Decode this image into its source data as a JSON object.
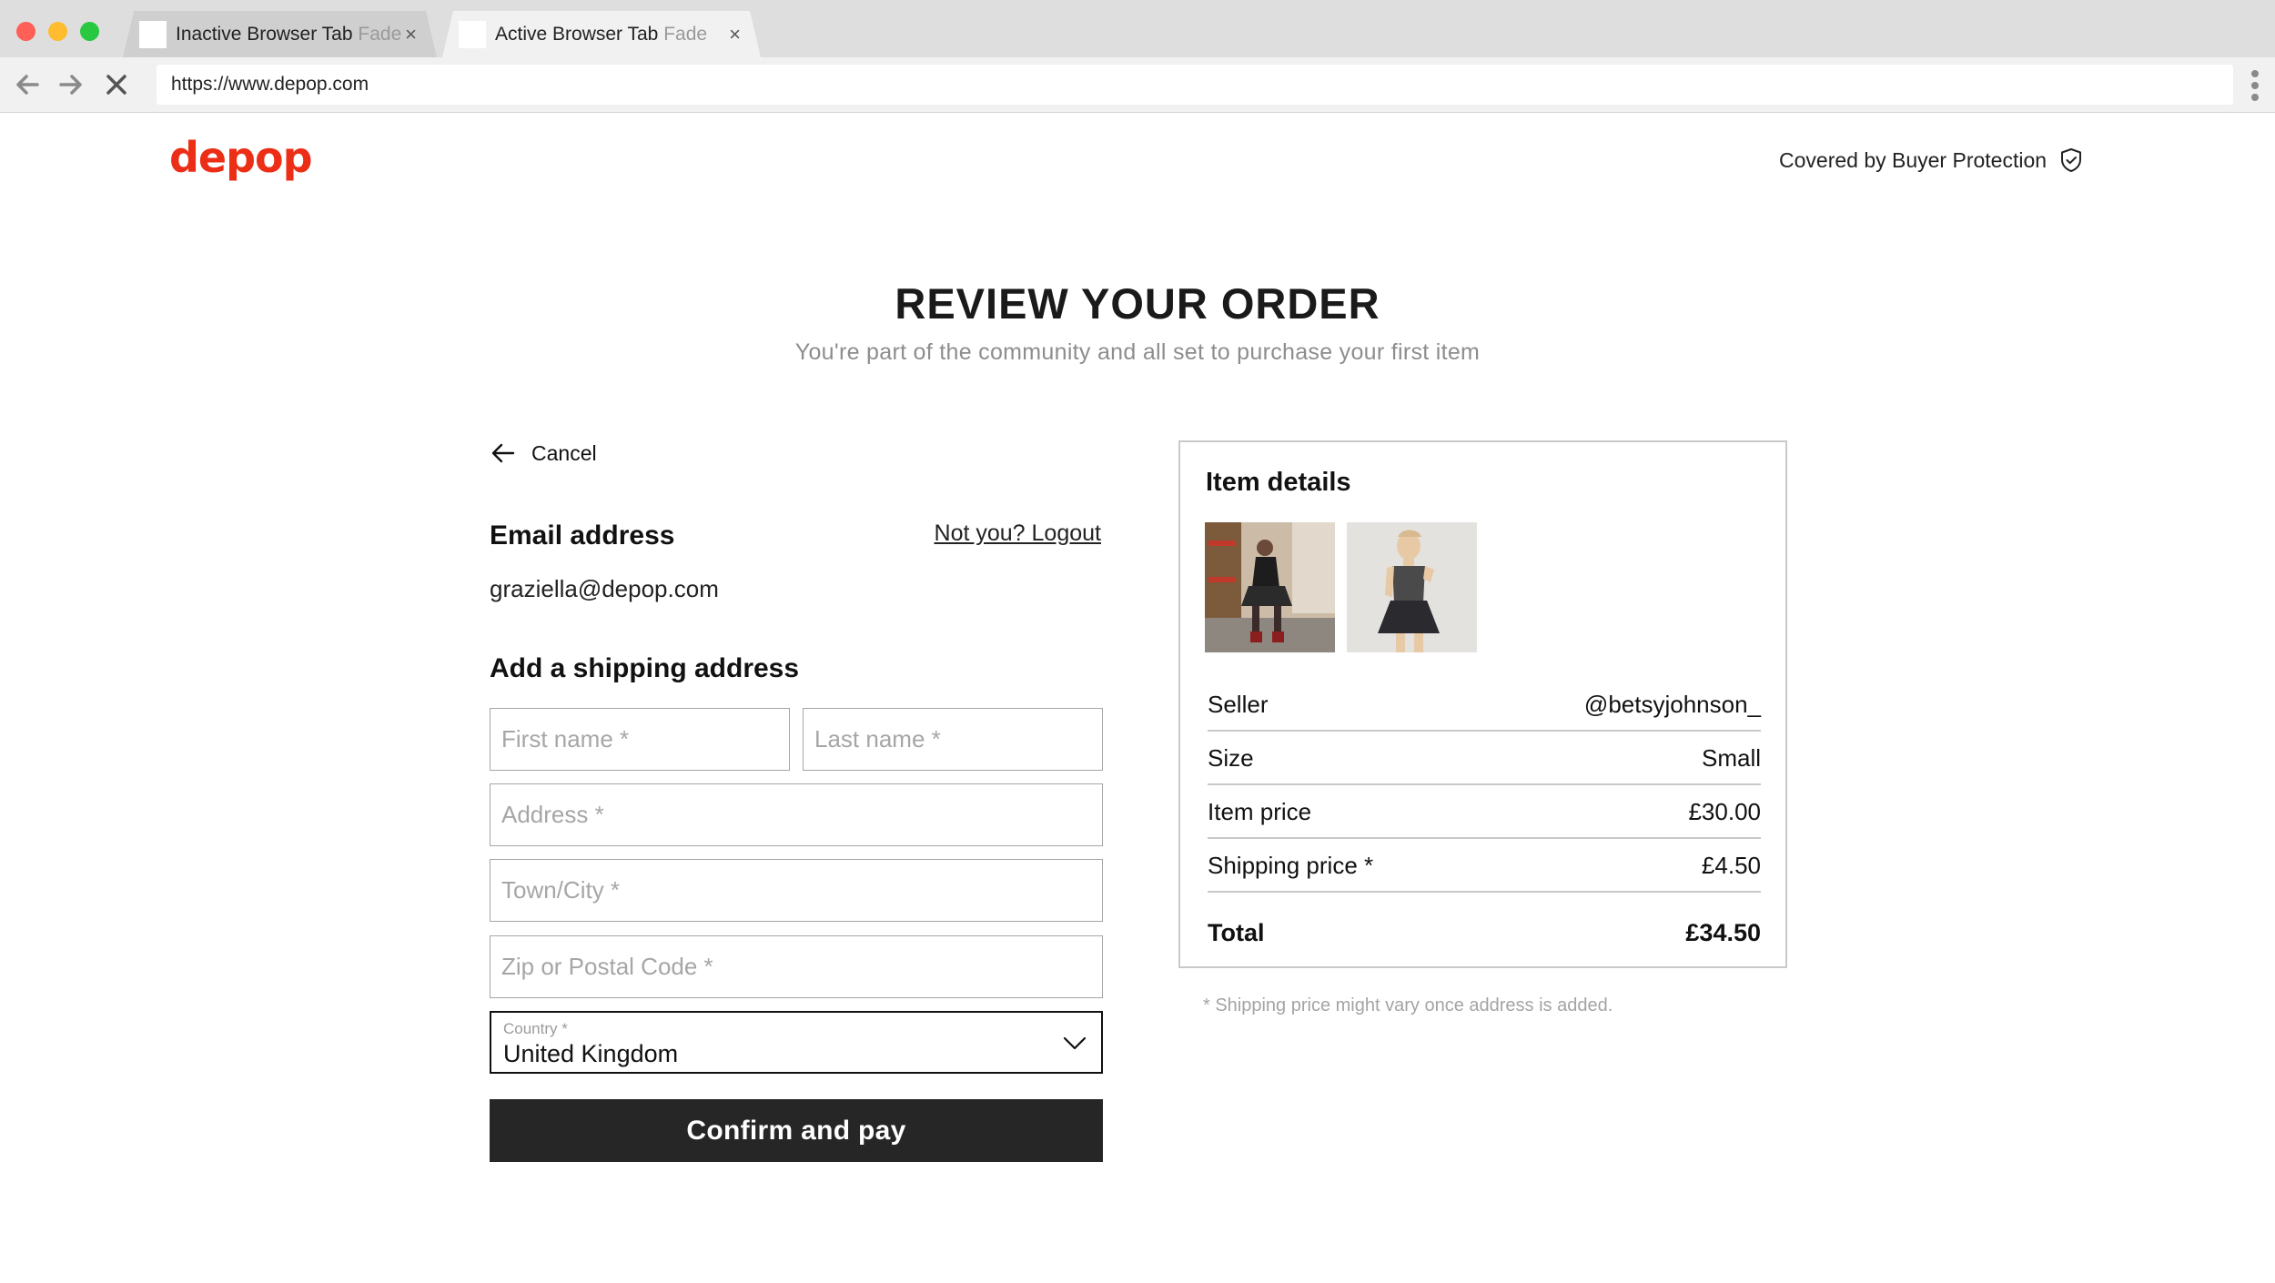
{
  "browser": {
    "tabs": [
      {
        "label": "Inactive Browser Tab",
        "fade": "Fade",
        "active": false
      },
      {
        "label": "Active Browser Tab",
        "fade": "Fade",
        "active": true
      }
    ],
    "url": "https://www.depop.com",
    "close_glyph": "×"
  },
  "header": {
    "logo": "depop",
    "logo_color": "#ec2e17",
    "protection_text": "Covered by Buyer Protection",
    "protection_icon": "shield-check-icon"
  },
  "page": {
    "title": "REVIEW YOUR ORDER",
    "subtitle": "You're part of the community and all set to purchase your first item"
  },
  "form": {
    "cancel_label": "Cancel",
    "email_heading": "Email address",
    "logout_label": "Not you? Logout",
    "email_value": "graziella@depop.com",
    "shipping_heading": "Add a shipping address",
    "placeholders": {
      "first_name": "First name *",
      "last_name": "Last name *",
      "address": "Address *",
      "town": "Town/City *",
      "zip": "Zip or Postal Code *"
    },
    "country_label": "Country *",
    "country_value": "United Kingdom",
    "confirm_label": "Confirm and pay",
    "button_color": "#262626"
  },
  "item": {
    "heading": "Item details",
    "rows": [
      {
        "label": "Seller",
        "value": "@betsyjohnson_"
      },
      {
        "label": "Size",
        "value": "Small"
      },
      {
        "label": "Item price",
        "value": "£30.00"
      },
      {
        "label": "Shipping price *",
        "value": "£4.50"
      }
    ],
    "total_label": "Total",
    "total_value": "£34.50",
    "footnote": "* Shipping price might vary once address is added."
  }
}
